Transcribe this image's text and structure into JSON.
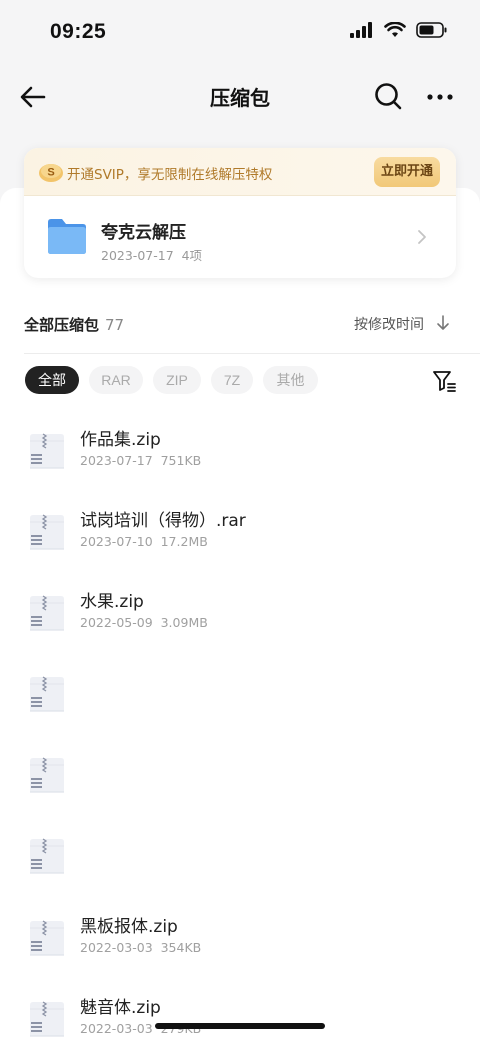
{
  "status_bar": {
    "time": "09:25"
  },
  "nav": {
    "title": "压缩包"
  },
  "vip": {
    "text": "开通SVIP，享无限制在线解压特权",
    "button": "立即开通"
  },
  "folder": {
    "name": "夸克云解压",
    "date": "2023-07-17",
    "count": "4项"
  },
  "section": {
    "title": "全部压缩包",
    "count": "77",
    "sort_label": "按修改时间"
  },
  "chips": [
    "全部",
    "RAR",
    "ZIP",
    "7Z",
    "其他"
  ],
  "files": [
    {
      "name": "作品集.zip",
      "date": "2023-07-17",
      "size": "751KB"
    },
    {
      "name": "试岗培训（得物）.rar",
      "date": "2023-07-10",
      "size": "17.2MB"
    },
    {
      "name": "水果.zip",
      "date": "2022-05-09",
      "size": "3.09MB"
    },
    {
      "name": "",
      "date": "",
      "size": ""
    },
    {
      "name": "",
      "date": "",
      "size": ""
    },
    {
      "name": "",
      "date": "",
      "size": ""
    },
    {
      "name": "黑板报体.zip",
      "date": "2022-03-03",
      "size": "354KB"
    },
    {
      "name": "魅音体.zip",
      "date": "2022-03-03",
      "size": "279KB"
    }
  ],
  "colors": {
    "accent_gold": "#b07a2a",
    "folder_blue": "#5aa6f0",
    "chip_active": "#222222"
  }
}
